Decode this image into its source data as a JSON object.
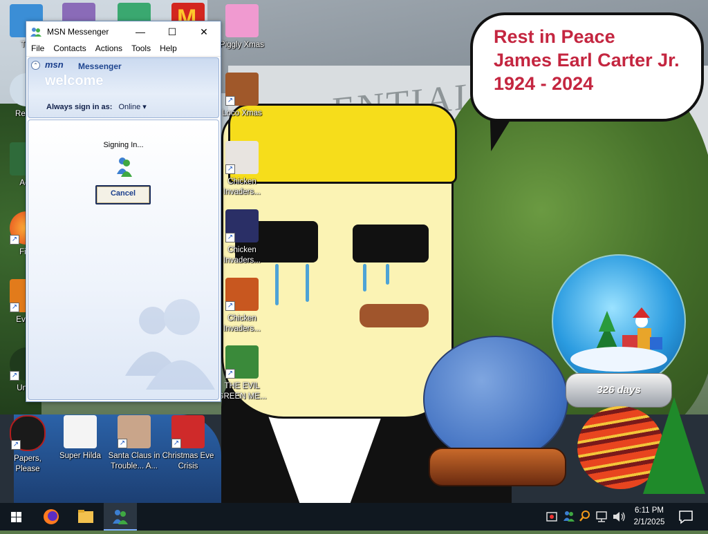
{
  "desktop": {
    "left_icons": [
      {
        "label": "Thi",
        "icon": "this-pc-icon"
      },
      {
        "label": "Recyc",
        "icon": "recycle-bin-icon"
      },
      {
        "label": "Acti",
        "icon": "activator-icon"
      },
      {
        "label": "Fire",
        "icon": "firefox-icon"
      },
      {
        "label": "Every",
        "icon": "everything-icon"
      },
      {
        "label": "Unde",
        "icon": "undertale-icon"
      }
    ],
    "top_icons": [
      {
        "label": "",
        "icon": "app-icon"
      },
      {
        "label": "",
        "icon": "character-icon"
      },
      {
        "label": "",
        "icon": "mcdonalds-icon"
      }
    ],
    "column_icons": [
      {
        "label": "Piggly Xmas",
        "icon": "piggly-xmas-icon"
      },
      {
        "label": "Loco Xmas",
        "icon": "loco-xmas-icon"
      },
      {
        "label": "Chicken Invaders...",
        "icon": "chicken-invaders-icon"
      },
      {
        "label": "Chicken Invaders...",
        "icon": "chicken-invaders-2-icon"
      },
      {
        "label": "Chicken Invaders...",
        "icon": "chicken-invaders-3-icon"
      },
      {
        "label": "THE EVIL GREEN ME...",
        "icon": "evil-green-me-icon"
      }
    ],
    "bottom_icons": [
      {
        "label": "Papers, Please",
        "icon": "papers-please-icon"
      },
      {
        "label": "Super Hilda",
        "icon": "super-hilda-icon"
      },
      {
        "label": "Santa Claus in Trouble... A...",
        "icon": "santa-claus-trouble-icon"
      },
      {
        "label": "Christmas Eve Crisis",
        "icon": "christmas-eve-crisis-icon"
      }
    ]
  },
  "wallpaper": {
    "sign_text": "ENTIAL",
    "bubble_lines": [
      "Rest in Peace",
      "James Earl Carter Jr.",
      "1924 - 2024"
    ],
    "globe_text": "326 days",
    "bubble_color": "#c42640"
  },
  "msn_window": {
    "title": "MSN Messenger",
    "controls": {
      "minimize": "—",
      "maximize": "☐",
      "close": "✕"
    },
    "menu": [
      "File",
      "Contacts",
      "Actions",
      "Tools",
      "Help"
    ],
    "logo": "msn",
    "brand": "Messenger",
    "welcome": "welcome",
    "signin_label": "Always sign in as:",
    "signin_status": "Online",
    "signing_text": "Signing In...",
    "cancel_label": "Cancel"
  },
  "taskbar": {
    "apps": [
      "start-icon",
      "firefox-icon",
      "file-explorer-icon",
      "msn-messenger-icon"
    ],
    "tray_icons": [
      "security-icon",
      "msn-tray-icon",
      "search-tray-icon",
      "network-icon",
      "volume-icon"
    ],
    "time": "6:11 PM",
    "date": "2/1/2025"
  }
}
